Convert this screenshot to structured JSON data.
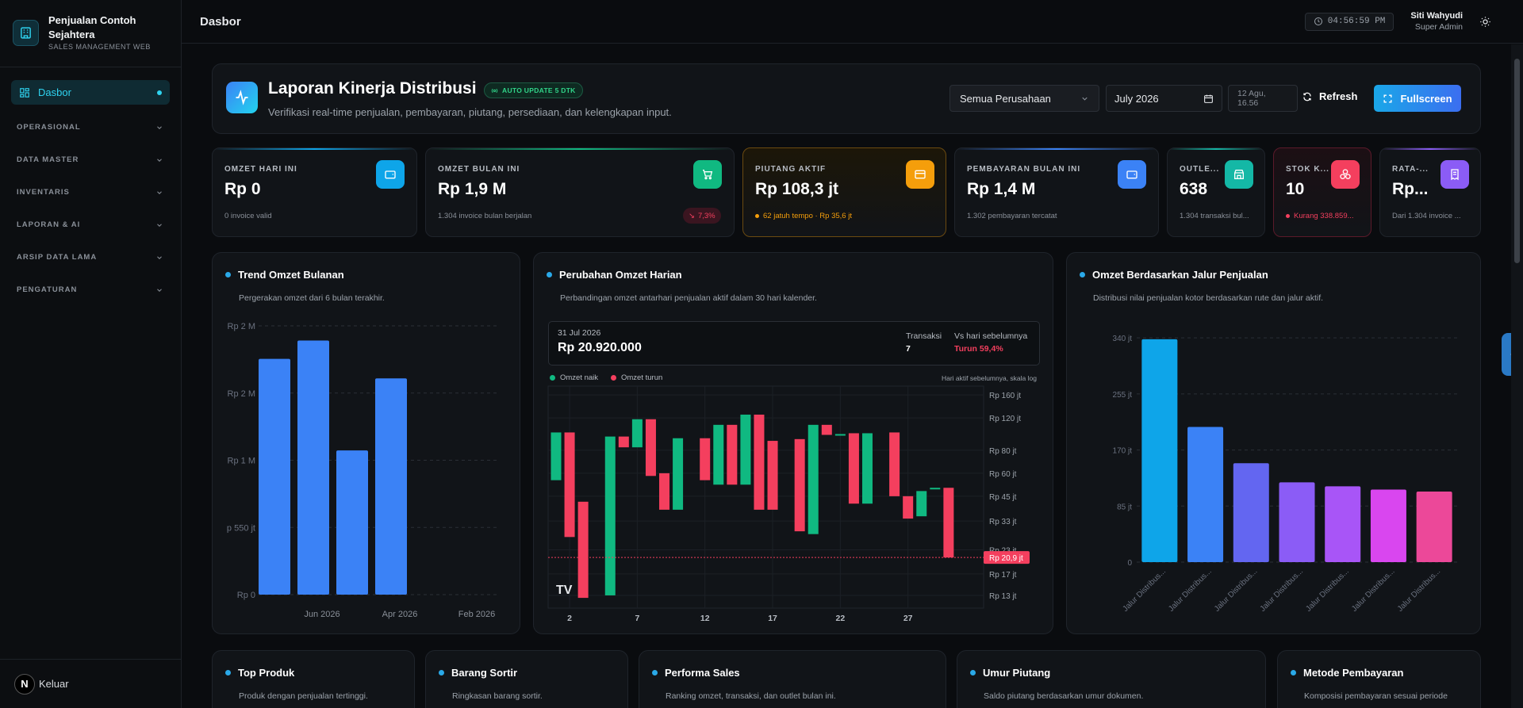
{
  "brand": {
    "name": "Penjualan Contoh Sejahtera",
    "subtitle": "SALES MANAGEMENT WEB"
  },
  "sidebar": {
    "active": "Dasbor",
    "sections": [
      "OPERASIONAL",
      "DATA MASTER",
      "INVENTARIS",
      "LAPORAN & AI",
      "ARSIP DATA LAMA",
      "PENGATURAN"
    ],
    "logout": "Keluar",
    "logo_letter": "N"
  },
  "topbar": {
    "title": "Dasbor",
    "clock": "04:56:59 PM",
    "user_name": "Siti Wahyudi",
    "user_role": "Super Admin"
  },
  "header": {
    "title": "Laporan Kinerja Distribusi",
    "badge": "AUTO UPDATE 5 DTK",
    "subtitle": "Verifikasi real-time penjualan, pembayaran, piutang, persediaan, dan kelengkapan input.",
    "company_select": "Semua Perusahaan",
    "month": "July 2026",
    "last_update": "12 Agu, 16.56",
    "refresh": "Refresh",
    "fullscreen": "Fullscreen"
  },
  "kpis": [
    {
      "label": "OMZET HARI INI",
      "value": "Rp 0",
      "sub": "0 invoice valid",
      "color": "#0ea5e9",
      "icon": "wallet-icon"
    },
    {
      "label": "OMZET BULAN INI",
      "value": "Rp 1,9 M",
      "sub": "1.304 invoice bulan berjalan",
      "badge": "7,3%",
      "color": "#10b981",
      "icon": "cart-icon"
    },
    {
      "label": "PIUTANG AKTIF",
      "value": "Rp 108,3 jt",
      "sub": "62 jatuh tempo · Rp 35,6 jt",
      "color": "#f59e0b",
      "icon": "card-icon"
    },
    {
      "label": "PEMBAYARAN BULAN INI",
      "value": "Rp 1,4 M",
      "sub": "1.302 pembayaran tercatat",
      "color": "#3b82f6",
      "icon": "wallet-icon"
    },
    {
      "label": "OUTLE...",
      "value": "638",
      "sub": "1.304 transaksi bul...",
      "color": "#14b8a6",
      "icon": "store-icon"
    },
    {
      "label": "STOK K...",
      "value": "10",
      "sub": "Kurang 338.859...",
      "color": "#f43f5e",
      "icon": "boxes-icon"
    },
    {
      "label": "RATA-...",
      "value": "Rp...",
      "sub": "Dari 1.304 invoice ...",
      "color": "#8b5cf6",
      "icon": "receipt-icon"
    }
  ],
  "trend_panel": {
    "title": "Trend Omzet Bulanan",
    "subtitle": "Pergerakan omzet dari 6 bulan terakhir."
  },
  "daily_panel": {
    "title": "Perubahan Omzet Harian",
    "subtitle": "Perbandingan omzet antarhari penjualan aktif dalam 30 hari kalender.",
    "tooltip": {
      "date": "31 Jul 2026",
      "value": "Rp 20.920.000",
      "tx_label": "Transaksi",
      "tx_value": "7",
      "vs_label": "Vs hari sebelumnya",
      "vs_value": "Turun 59,4%"
    },
    "legend_up": "Omzet naik",
    "legend_down": "Omzet turun",
    "note": "Hari aktif sebelumnya, skala log",
    "last_price_label": "Rp 20,9 jt"
  },
  "route_panel": {
    "title": "Omzet Berdasarkan Jalur Penjualan",
    "subtitle": "Distribusi nilai penjualan kotor berdasarkan rute dan jalur aktif."
  },
  "bottom_panels": [
    {
      "title": "Top Produk",
      "subtitle": "Produk dengan penjualan tertinggi."
    },
    {
      "title": "Barang Sortir",
      "subtitle": "Ringkasan barang sortir."
    },
    {
      "title": "Performa Sales",
      "subtitle": "Ranking omzet, transaksi, dan outlet bulan ini."
    },
    {
      "title": "Umur Piutang",
      "subtitle": "Saldo piutang berdasarkan umur dokumen."
    },
    {
      "title": "Metode Pembayaran",
      "subtitle": "Komposisi pembayaran sesuai periode"
    }
  ],
  "chart_data": [
    {
      "type": "bar",
      "title": "Trend Omzet Bulanan",
      "ytick_labels": [
        "Rp 0",
        "p 550 jt",
        "Rp 1 M",
        "Rp 2 M",
        "Rp 2 M"
      ],
      "xtick_labels": [
        "Jun 2026",
        "Apr 2026",
        "Feb 2026"
      ],
      "ylim": [
        0,
        2200
      ],
      "unit": "Rp jt",
      "values": [
        1930,
        2080,
        1180,
        1770
      ],
      "color": "#3b82f6",
      "grid": true
    },
    {
      "type": "candlestick",
      "title": "Perubahan Omzet Harian",
      "scale": "log",
      "ytick_labels": [
        "Rp 160 jt",
        "Rp 120 jt",
        "Rp 80 jt",
        "Rp 60 jt",
        "Rp 45 jt",
        "Rp 33 jt",
        "Rp 23 jt",
        "Rp 17 jt",
        "Rp 13 jt"
      ],
      "yticks": [
        160,
        120,
        80,
        60,
        45,
        33,
        23,
        17,
        13
      ],
      "xtick_labels": [
        "2",
        "7",
        "12",
        "17",
        "22",
        "27"
      ],
      "xticks": [
        2,
        7,
        12,
        17,
        22,
        27
      ],
      "ylim": [
        12,
        165
      ],
      "xlim": [
        1,
        32
      ],
      "unit": "Rp jt",
      "candles": [
        {
          "day": 1,
          "open": 55,
          "close": 100
        },
        {
          "day": 2,
          "open": 100,
          "close": 27
        },
        {
          "day": 3,
          "open": 42,
          "close": 12.6
        },
        {
          "day": 5,
          "open": 13,
          "close": 95
        },
        {
          "day": 6,
          "open": 95,
          "close": 83
        },
        {
          "day": 7,
          "open": 83,
          "close": 118
        },
        {
          "day": 8,
          "open": 118,
          "close": 58
        },
        {
          "day": 9,
          "open": 60,
          "close": 38
        },
        {
          "day": 10,
          "open": 38,
          "close": 93
        },
        {
          "day": 12,
          "open": 93,
          "close": 55
        },
        {
          "day": 13,
          "open": 52,
          "close": 110
        },
        {
          "day": 14,
          "open": 110,
          "close": 52
        },
        {
          "day": 15,
          "open": 52,
          "close": 125
        },
        {
          "day": 16,
          "open": 125,
          "close": 38
        },
        {
          "day": 17,
          "open": 90,
          "close": 38
        },
        {
          "day": 19,
          "open": 92,
          "close": 29
        },
        {
          "day": 20,
          "open": 28,
          "close": 110
        },
        {
          "day": 21,
          "open": 110,
          "close": 97
        },
        {
          "day": 22,
          "open": 98,
          "close": 98
        },
        {
          "day": 23,
          "open": 99,
          "close": 41
        },
        {
          "day": 24,
          "open": 41,
          "close": 99
        },
        {
          "day": 26,
          "open": 100,
          "close": 45
        },
        {
          "day": 27,
          "open": 45,
          "close": 34
        },
        {
          "day": 28,
          "open": 35,
          "close": 48
        },
        {
          "day": 29,
          "open": 50,
          "close": 50
        },
        {
          "day": 30,
          "open": 50,
          "close": 20.9
        }
      ],
      "up_color": "#10b981",
      "down_color": "#f43f5e",
      "last_price": 20.9
    },
    {
      "type": "bar",
      "title": "Omzet Berdasarkan Jalur Penjualan",
      "ytick_labels": [
        "0",
        "85 jt",
        "170 jt",
        "255 jt",
        "340 jt"
      ],
      "yticks": [
        0,
        85,
        170,
        255,
        340
      ],
      "ylim": [
        0,
        345
      ],
      "unit": "Rp jt",
      "categories": [
        "Jalur Distribus...",
        "Jalur Distribus...",
        "Jalur Distribus...",
        "Jalur Distribus...",
        "Jalur Distribus...",
        "Jalur Distribus...",
        "Jalur Distribus..."
      ],
      "values": [
        338,
        205,
        150,
        121,
        115,
        110,
        107
      ],
      "colors": [
        "#0ea5e9",
        "#3b82f6",
        "#6366f1",
        "#8b5cf6",
        "#a855f7",
        "#d946ef",
        "#ec4899"
      ],
      "grid": true
    }
  ]
}
